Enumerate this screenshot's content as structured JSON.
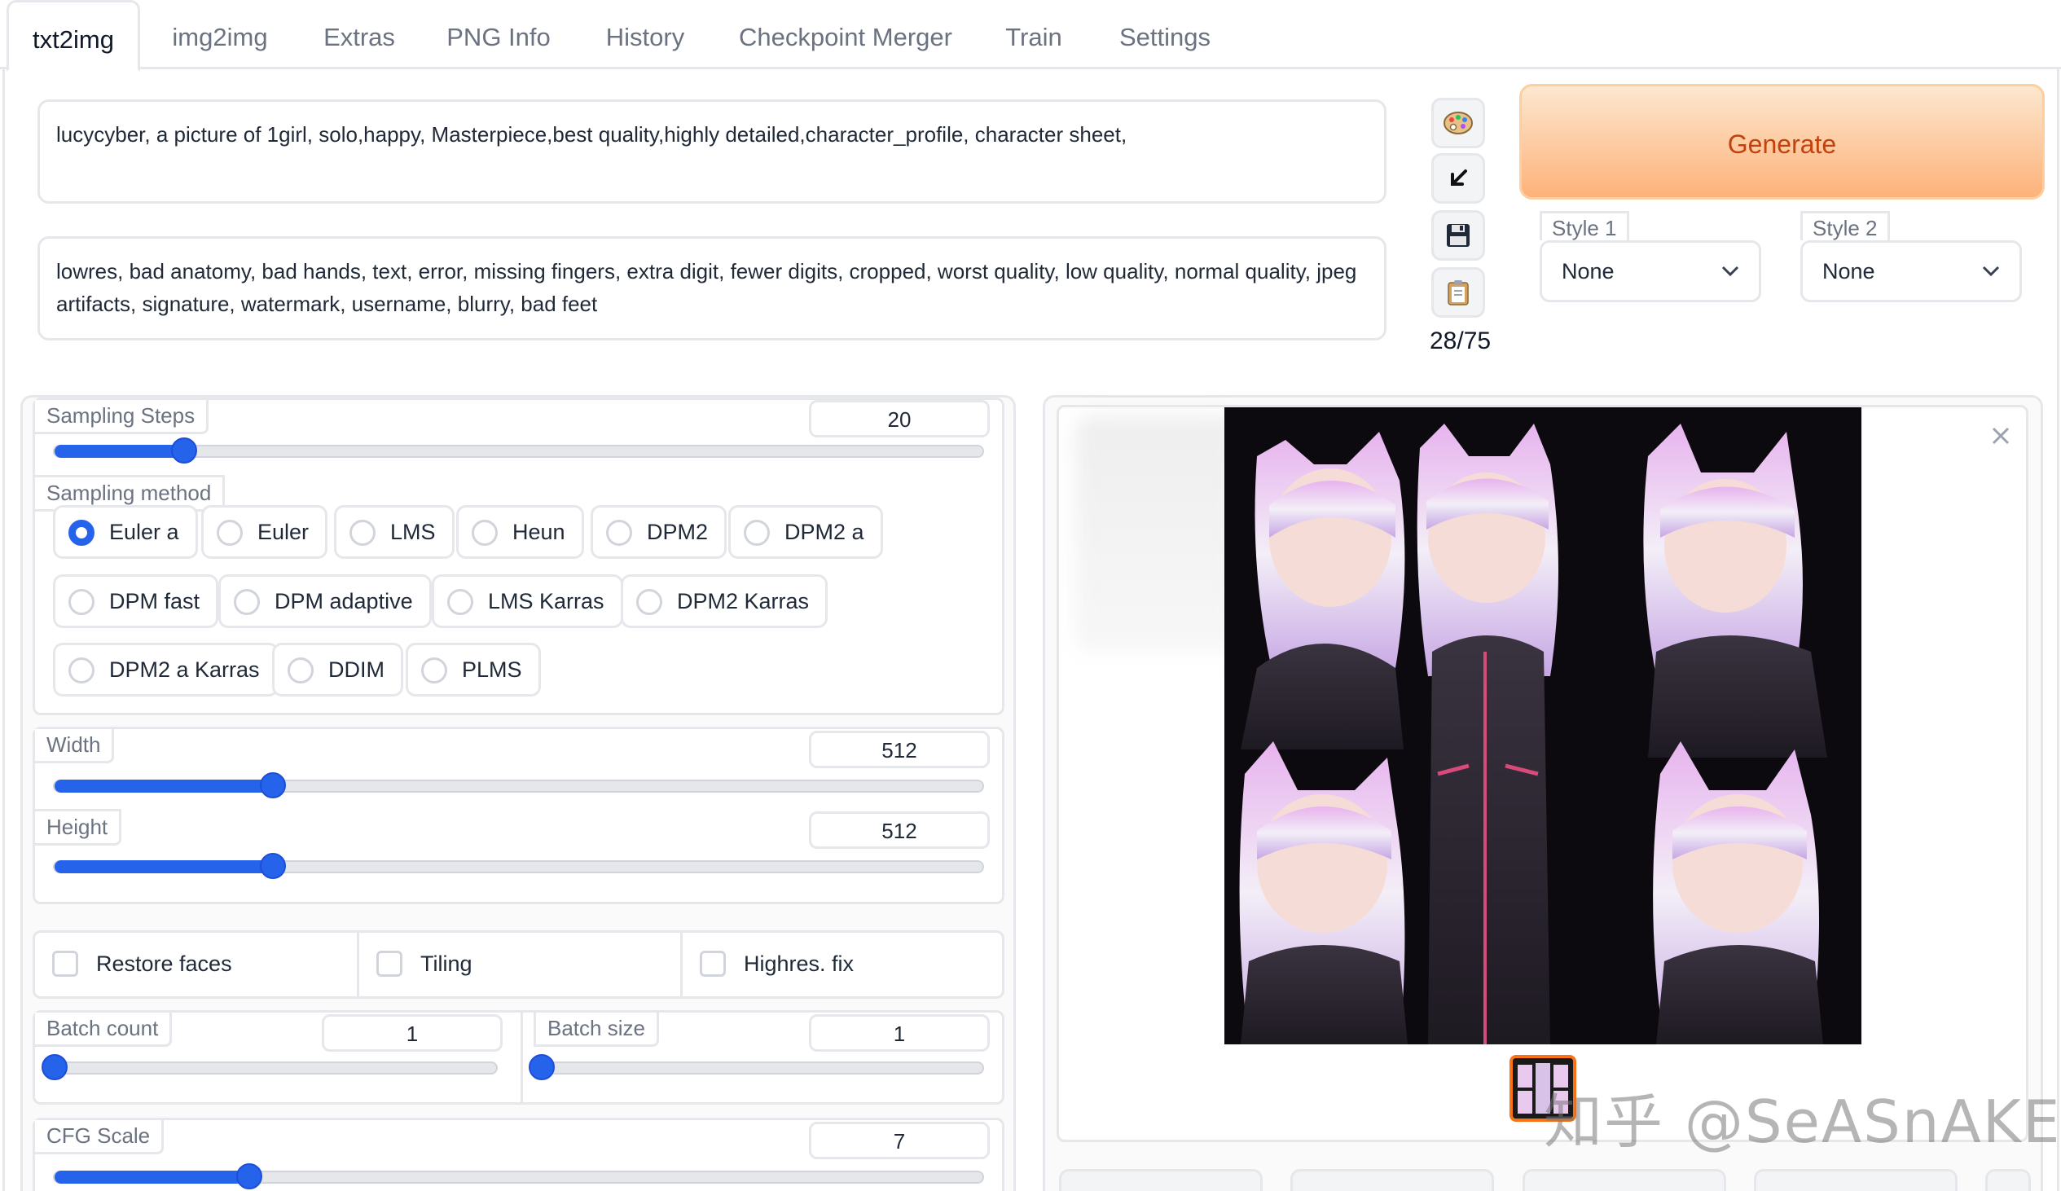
{
  "tabs": [
    "txt2img",
    "img2img",
    "Extras",
    "PNG Info",
    "History",
    "Checkpoint Merger",
    "Train",
    "Settings"
  ],
  "prompt": {
    "positive": "lucycyber, a picture of 1girl, solo,happy, Masterpiece,best quality,highly detailed,character_profile,  character sheet,",
    "negative": "lowres, bad anatomy, bad hands, text, error, missing fingers, extra digit, fewer digits, cropped, worst quality, low quality, normal quality, jpeg artifacts, signature, watermark, username, blurry, bad feet"
  },
  "tools": {
    "icons": [
      "palette-icon",
      "arrow-down-left-icon",
      "save-icon",
      "clipboard-icon"
    ],
    "token_count": "28/75"
  },
  "generate": {
    "label": "Generate",
    "accent": "#f97316"
  },
  "styles": [
    {
      "label": "Style 1",
      "value": "None"
    },
    {
      "label": "Style 2",
      "value": "None"
    }
  ],
  "sampling": {
    "steps": {
      "label": "Sampling Steps",
      "value": "20",
      "fraction": 0.14
    },
    "method_label": "Sampling method",
    "methods": [
      "Euler a",
      "Euler",
      "LMS",
      "Heun",
      "DPM2",
      "DPM2 a",
      "DPM fast",
      "DPM adaptive",
      "LMS Karras",
      "DPM2 Karras",
      "DPM2 a Karras",
      "DDIM",
      "PLMS"
    ],
    "selected": "Euler a"
  },
  "size": {
    "width": {
      "label": "Width",
      "value": "512",
      "fraction": 0.235
    },
    "height": {
      "label": "Height",
      "value": "512",
      "fraction": 0.235
    }
  },
  "options": [
    "Restore faces",
    "Tiling",
    "Highres. fix"
  ],
  "batch": {
    "count": {
      "label": "Batch count",
      "value": "1",
      "fraction": 0.0
    },
    "size": {
      "label": "Batch size",
      "value": "1",
      "fraction": 0.0
    }
  },
  "cfg": {
    "label": "CFG Scale",
    "value": "7",
    "fraction": 0.21
  },
  "watermark": "知乎 @SeASnAKE",
  "accent": "#2563eb"
}
